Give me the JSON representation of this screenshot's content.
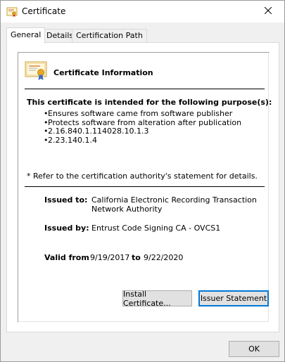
{
  "window": {
    "title": "Certificate",
    "icons": {
      "title": "certificate-icon",
      "close": "close-icon"
    }
  },
  "tabs": [
    {
      "label": "General",
      "active": true
    },
    {
      "label": "Details",
      "active": false
    },
    {
      "label": "Certification Path",
      "active": false
    }
  ],
  "info": {
    "title": "Certificate Information",
    "icon": "certificate-icon",
    "purpose_heading": "This certificate is intended for the following purpose(s):",
    "purposes": [
      "Ensures software came from software publisher",
      "Protects software from alteration after publication",
      "2.16.840.1.114028.10.1.3",
      "2.23.140.1.4"
    ],
    "refer_note": "* Refer to the certification authority's statement for details.",
    "issued_to_label": "Issued to:",
    "issued_to_line1": "California Electronic Recording Transaction",
    "issued_to_line2": "Network Authority",
    "issued_by_label": "Issued by:",
    "issued_by_value": "Entrust Code Signing CA - OVCS1",
    "valid_from_label": "Valid from",
    "valid_from_value": "9/19/2017",
    "valid_to_label": "to",
    "valid_to_value": "9/22/2020"
  },
  "buttons": {
    "install": "Install Certificate...",
    "issuer": "Issuer Statement",
    "ok": "OK"
  },
  "colors": {
    "focus": "#0078d7",
    "button_bg": "#e1e1e1",
    "dialog_bg": "#f0f0f0"
  }
}
